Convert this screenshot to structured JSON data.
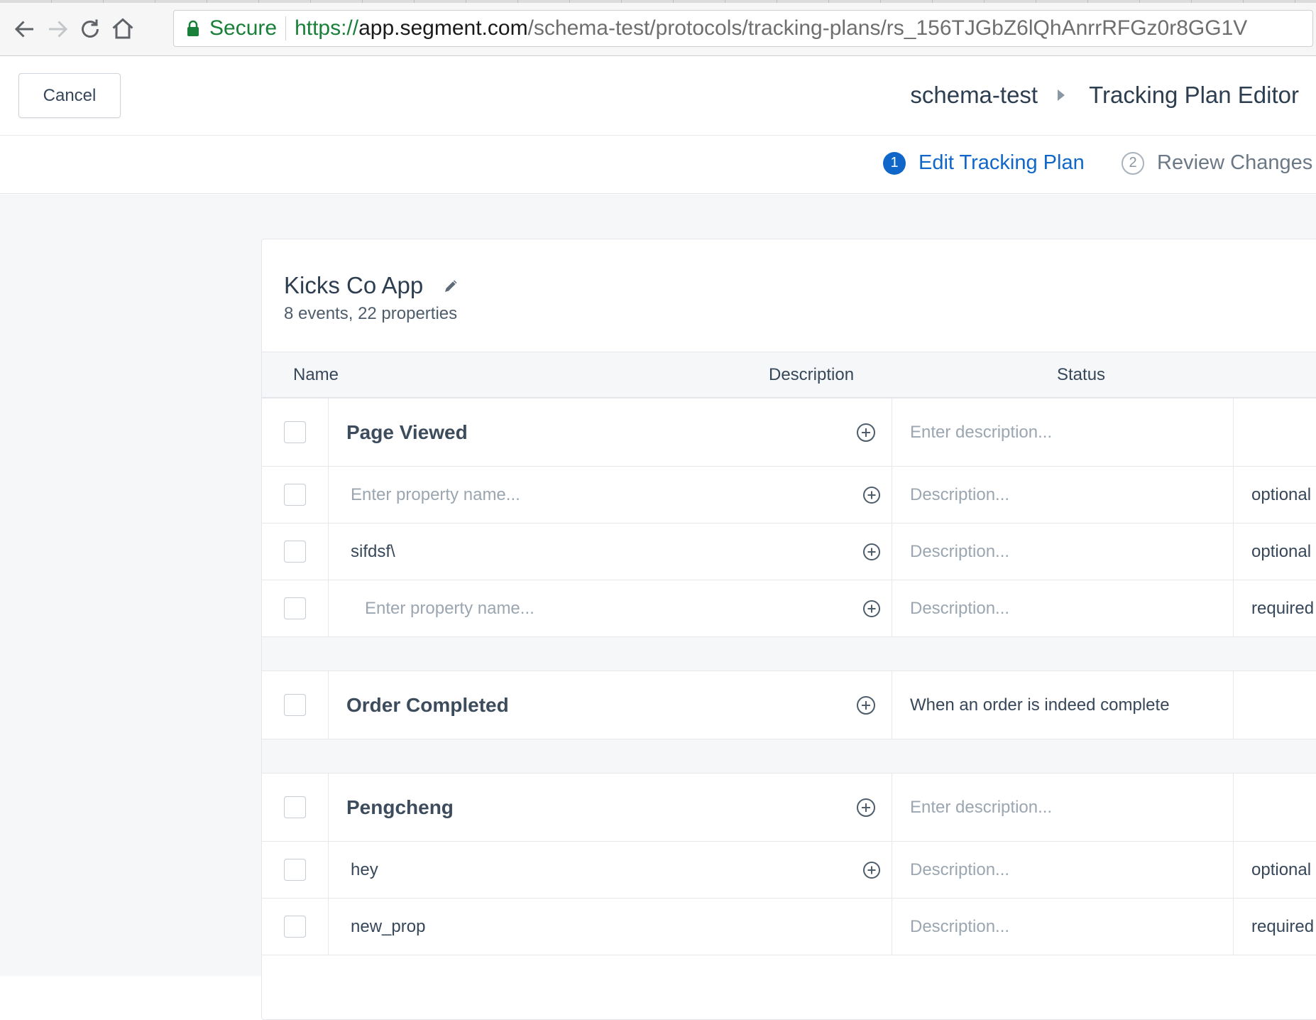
{
  "browser": {
    "secure_label": "Secure",
    "url_scheme": "https://",
    "url_host": "app.segment.com",
    "url_path": "/schema-test/protocols/tracking-plans/rs_156TJGbZ6lQhAnrrRFGz0r8GG1V"
  },
  "header": {
    "cancel_label": "Cancel",
    "breadcrumb": [
      "schema-test",
      "Tracking Plan Editor"
    ]
  },
  "steps": [
    {
      "number": "1",
      "label": "Edit Tracking Plan",
      "active": true
    },
    {
      "number": "2",
      "label": "Review Changes",
      "active": false
    }
  ],
  "plan": {
    "title": "Kicks Co App",
    "summary": "8 events, 22 properties"
  },
  "table": {
    "columns": {
      "name": "Name",
      "description": "Description",
      "status": "Status"
    },
    "events": [
      {
        "name": "Page Viewed",
        "description_placeholder": "Enter description...",
        "description": "",
        "properties": [
          {
            "name": "",
            "name_placeholder": "Enter property name...",
            "description_placeholder": "Description...",
            "status": "optional"
          },
          {
            "name": "sifdsf\\",
            "name_placeholder": "",
            "description_placeholder": "Description...",
            "status": "optional"
          },
          {
            "name": "",
            "name_placeholder": "Enter property name...",
            "description_placeholder": "Description...",
            "status": "required"
          }
        ]
      },
      {
        "name": "Order Completed",
        "description_placeholder": "",
        "description": "When an order is indeed complete",
        "properties": []
      },
      {
        "name": "Pengcheng",
        "description_placeholder": "Enter description...",
        "description": "",
        "properties": [
          {
            "name": "hey",
            "name_placeholder": "",
            "description_placeholder": "Description...",
            "status": "optional"
          },
          {
            "name": "new_prop",
            "name_placeholder": "",
            "description_placeholder": "Description...",
            "status": "required"
          }
        ]
      }
    ]
  },
  "icons": {
    "back": "arrow-left-icon",
    "forward": "arrow-right-icon",
    "reload": "reload-icon",
    "home": "home-icon",
    "lock": "lock-icon",
    "edit": "pencil-icon",
    "add": "plus-circle-icon"
  },
  "colors": {
    "accent": "#1067c9",
    "secure_green": "#188038",
    "placeholder": "#9ba6b1"
  }
}
